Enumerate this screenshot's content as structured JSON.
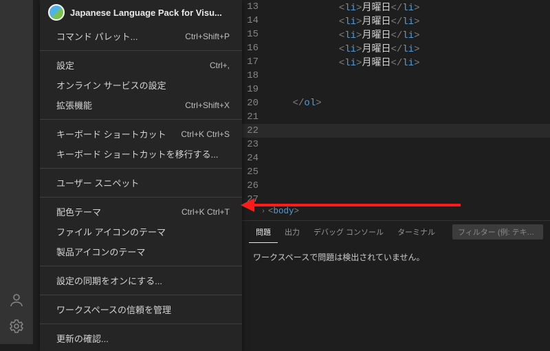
{
  "menu": {
    "header": "Japanese Language Pack for Visu...",
    "groups": [
      [
        {
          "label": "コマンド パレット...",
          "shortcut": "Ctrl+Shift+P"
        }
      ],
      [
        {
          "label": "設定",
          "shortcut": "Ctrl+,"
        },
        {
          "label": "オンライン サービスの設定",
          "shortcut": ""
        },
        {
          "label": "拡張機能",
          "shortcut": "Ctrl+Shift+X"
        }
      ],
      [
        {
          "label": "キーボード ショートカット",
          "shortcut": "Ctrl+K Ctrl+S"
        },
        {
          "label": "キーボード ショートカットを移行する...",
          "shortcut": ""
        }
      ],
      [
        {
          "label": "ユーザー スニペット",
          "shortcut": ""
        }
      ],
      [
        {
          "label": "配色テーマ",
          "shortcut": "Ctrl+K Ctrl+T"
        },
        {
          "label": "ファイル アイコンのテーマ",
          "shortcut": ""
        },
        {
          "label": "製品アイコンのテーマ",
          "shortcut": ""
        }
      ],
      [
        {
          "label": "設定の同期をオンにする...",
          "shortcut": ""
        }
      ],
      [
        {
          "label": "ワークスペースの信頼を管理",
          "shortcut": ""
        }
      ],
      [
        {
          "label": "更新の確認...",
          "shortcut": ""
        }
      ]
    ]
  },
  "editor": {
    "lines": [
      {
        "n": 13,
        "indent": 3,
        "kind": "li",
        "text": "月曜日"
      },
      {
        "n": 14,
        "indent": 3,
        "kind": "li",
        "text": "月曜日"
      },
      {
        "n": 15,
        "indent": 3,
        "kind": "li",
        "text": "月曜日"
      },
      {
        "n": 16,
        "indent": 3,
        "kind": "li",
        "text": "月曜日"
      },
      {
        "n": 17,
        "indent": 3,
        "kind": "li",
        "text": "月曜日"
      },
      {
        "n": 18,
        "indent": 0,
        "kind": "blank"
      },
      {
        "n": 19,
        "indent": 0,
        "kind": "blank"
      },
      {
        "n": 20,
        "indent": 1,
        "kind": "close-ol"
      },
      {
        "n": 21,
        "indent": 0,
        "kind": "blank"
      },
      {
        "n": 22,
        "indent": 0,
        "kind": "current"
      },
      {
        "n": 23,
        "indent": 0,
        "kind": "blank"
      },
      {
        "n": 24,
        "indent": 0,
        "kind": "blank"
      },
      {
        "n": 25,
        "indent": 0,
        "kind": "blank"
      },
      {
        "n": 26,
        "indent": 0,
        "kind": "blank"
      },
      {
        "n": 27,
        "indent": 0,
        "kind": "blank"
      }
    ]
  },
  "breadcrumb": {
    "tag_open": "<",
    "tag_name": "body",
    "tag_close": ">"
  },
  "panel": {
    "tabs": [
      "問題",
      "出力",
      "デバッグ コンソール",
      "ターミナル"
    ],
    "active_index": 0,
    "filter_placeholder": "フィルター (例: テキスト、**",
    "body": "ワークスペースで問題は検出されていません。"
  }
}
